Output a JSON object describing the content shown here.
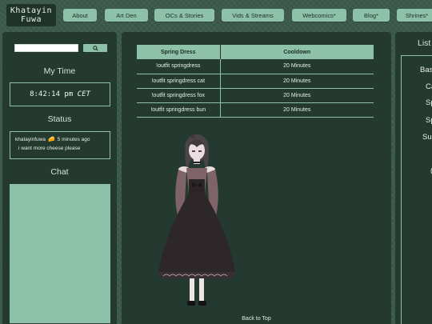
{
  "site": {
    "logo_line1": "Khatayin",
    "logo_line2": "Fuwa"
  },
  "nav": [
    {
      "label": "About"
    },
    {
      "label": "Art Den"
    },
    {
      "label": "OCs & Stories"
    },
    {
      "label": "Vids & Streams"
    },
    {
      "label": "Webcomics*"
    },
    {
      "label": "Blog*"
    },
    {
      "label": "Shrines*"
    }
  ],
  "sidebar": {
    "search": {
      "value": "",
      "placeholder": "",
      "button_icon": "search-icon"
    },
    "time_title": "My Time",
    "time_value": "8:42:14 pm",
    "time_zone": "CET",
    "status_title": "Status",
    "status_user": "khatayinfuwa",
    "status_emoji": "🧀",
    "status_ago": "5 minutes ago",
    "status_text": "i want more cheese please",
    "chat_title": "Chat"
  },
  "table": {
    "headers": [
      "Spring Dress",
      "Cooldown"
    ],
    "rows": [
      [
        "!outfit springdress",
        "20 Minutes"
      ],
      [
        "!outfit springdress cat",
        "20 Minutes"
      ],
      [
        "!outfit springdress fox",
        "20 Minutes"
      ],
      [
        "!outfit springdress bun",
        "20 Minutes"
      ]
    ]
  },
  "main": {
    "back_to_top": "Back to Top"
  },
  "right": {
    "title": "List",
    "items": [
      "Bas",
      "Ca",
      "Sp",
      "Sp",
      "Su",
      "("
    ]
  },
  "colors": {
    "accent": "#8ec1aa",
    "panel": "#243a30",
    "background": "#3b5a4c"
  }
}
